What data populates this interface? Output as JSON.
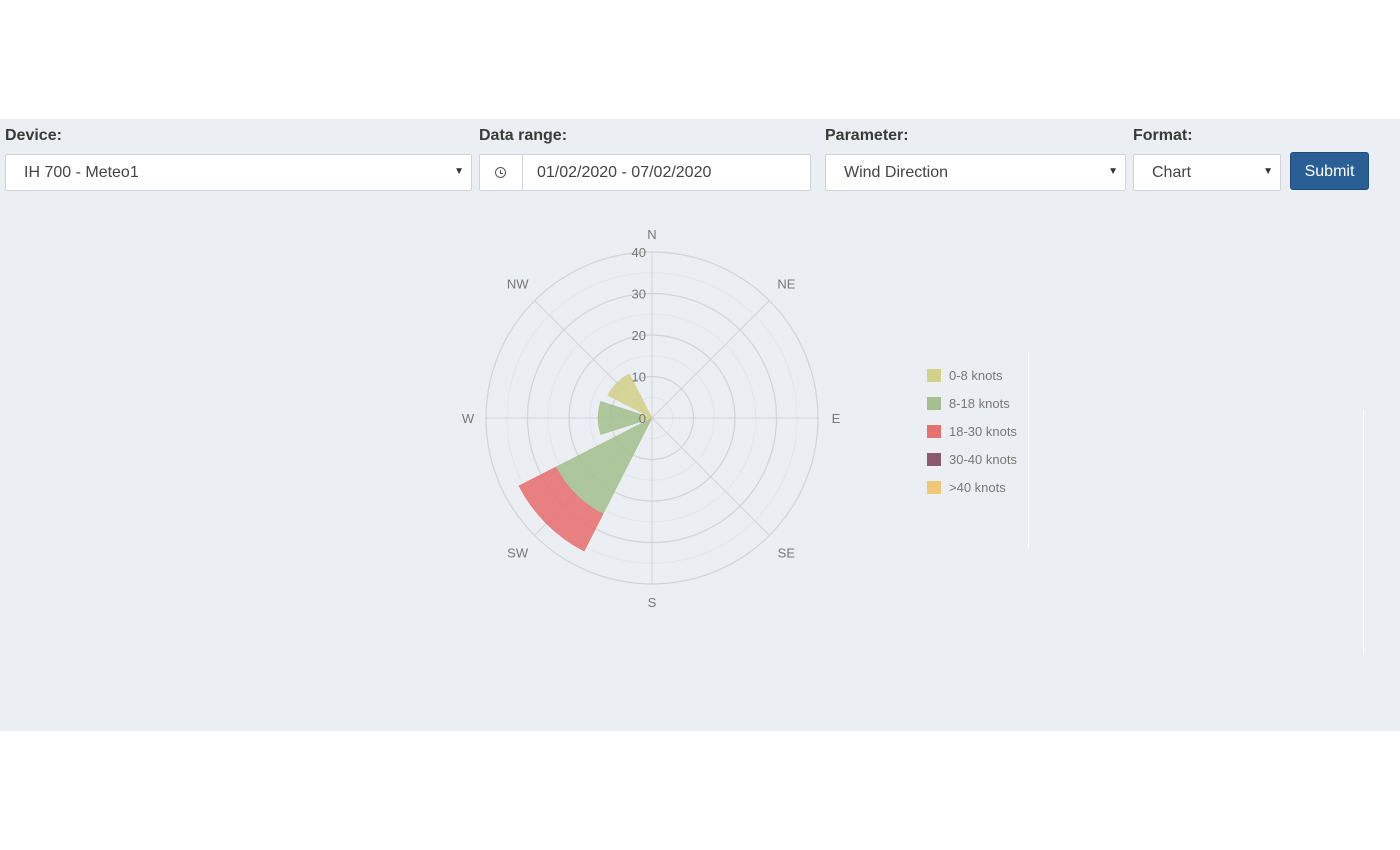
{
  "filters": {
    "device": {
      "label": "Device:",
      "value": "IH 700 - Meteo1"
    },
    "date_range": {
      "label": "Data range:",
      "value": "01/02/2020 - 07/02/2020"
    },
    "parameter": {
      "label": "Parameter:",
      "value": "Wind Direction"
    },
    "format": {
      "label": "Format:",
      "value": "Chart"
    },
    "submit_label": "Submit"
  },
  "chart_data": {
    "type": "polar-bar",
    "categories": [
      "N",
      "NE",
      "E",
      "SE",
      "S",
      "SW",
      "W",
      "NW"
    ],
    "radial_ticks": [
      0,
      10,
      20,
      30,
      40
    ],
    "rmax": 40,
    "series": [
      {
        "name": "0-8 knots",
        "color": "#d3d08a",
        "values": [
          0,
          0,
          0,
          0,
          0,
          0,
          3,
          12
        ]
      },
      {
        "name": "8-18 knots",
        "color": "#a4c08e",
        "values": [
          0,
          0,
          0,
          0,
          0,
          26,
          10,
          0
        ]
      },
      {
        "name": "18-30 knots",
        "color": "#e77070",
        "values": [
          0,
          0,
          0,
          0,
          0,
          10,
          0,
          0
        ]
      },
      {
        "name": "30-40 knots",
        "color": "#8b5a6e",
        "values": [
          0,
          0,
          0,
          0,
          0,
          0,
          0,
          0
        ]
      },
      {
        "name": ">40 knots",
        "color": "#eec878",
        "values": [
          0,
          0,
          0,
          0,
          0,
          0,
          0,
          0
        ]
      }
    ]
  }
}
